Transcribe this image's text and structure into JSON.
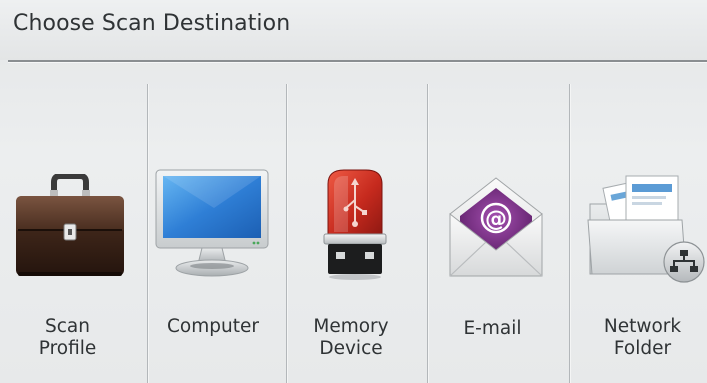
{
  "header": {
    "title": "Choose Scan Destination"
  },
  "destinations": [
    {
      "label": "Scan\nProfile",
      "icon": "briefcase-icon"
    },
    {
      "label": "Computer",
      "icon": "computer-monitor-icon"
    },
    {
      "label": "Memory\nDevice",
      "icon": "usb-drive-icon"
    },
    {
      "label": "E-mail",
      "icon": "email-envelope-icon"
    },
    {
      "label": "Network\nFolder",
      "icon": "network-folder-icon"
    }
  ],
  "colors": {
    "background": "#e6e8e9",
    "text": "#2f3335",
    "divider": "#b3b7ba",
    "email_accent": "#7a2c86",
    "usb_red": "#c62a1e",
    "monitor_blue": "#2f7fd6"
  }
}
